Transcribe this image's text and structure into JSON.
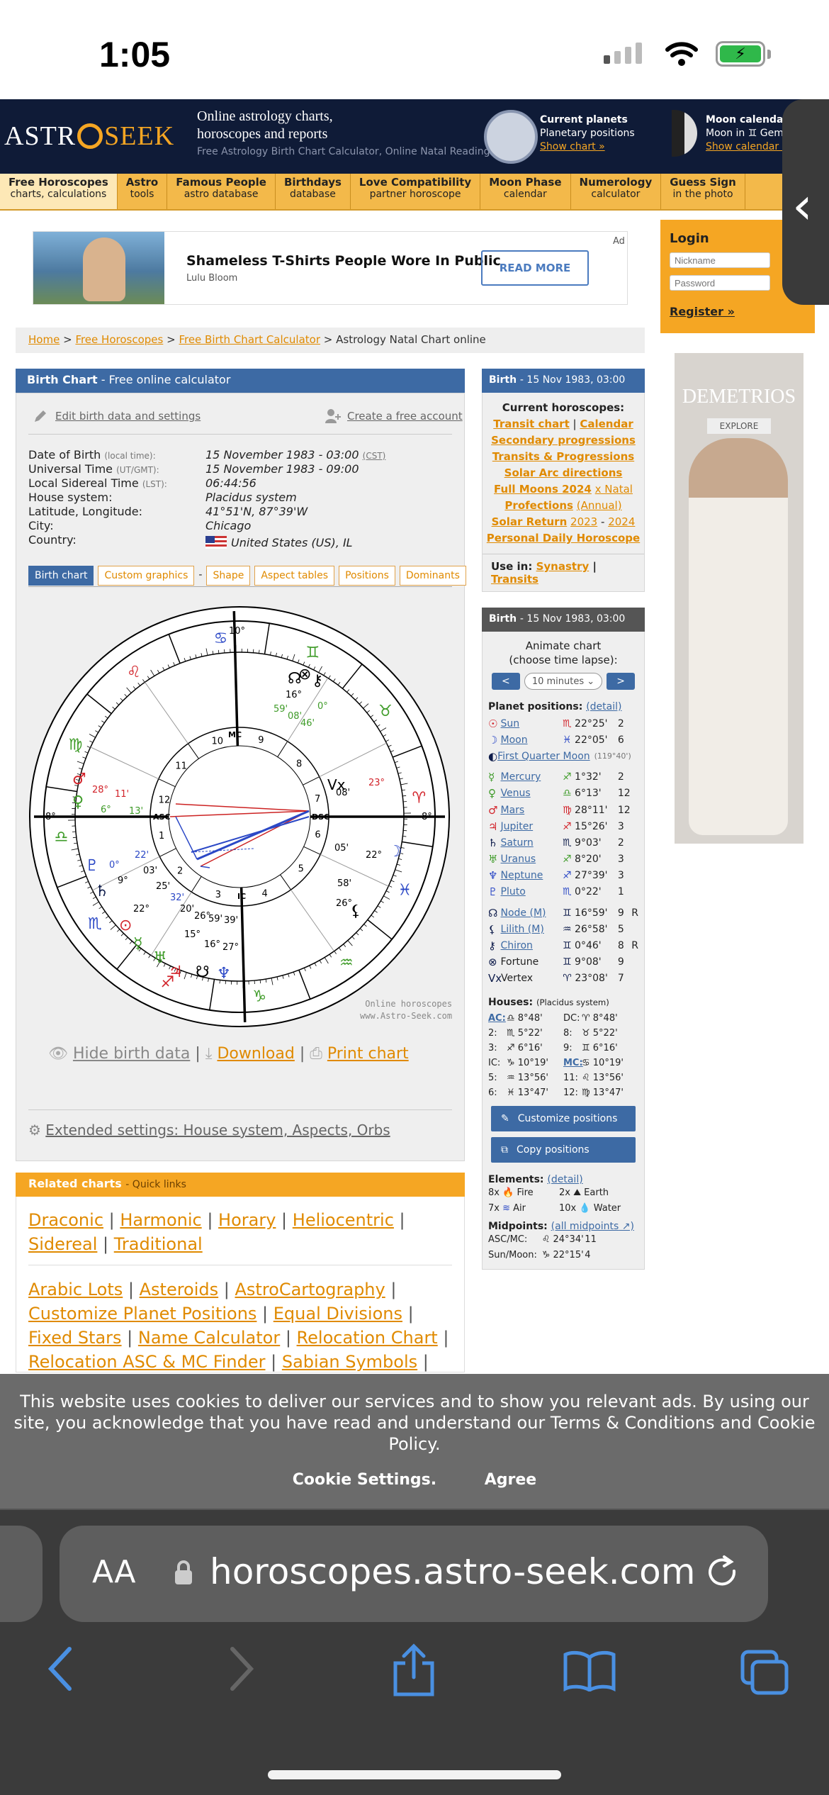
{
  "status": {
    "time": "1:05"
  },
  "header": {
    "logo_astro": "ASTR",
    "logo_seek": "SEEK",
    "tagline": "Online astrology charts, horoscopes and reports",
    "subtagline": "Free Astrology Birth Chart Calculator, Online Natal Reading",
    "planets_title": "Current planets",
    "planets_sub": "Planetary positions",
    "planets_link": "Show chart »",
    "moon_title": "Moon calendar",
    "moon_sub": "Moon in ♊ Gem",
    "moon_link": "Show calendar »"
  },
  "nav": [
    {
      "title": "Free Horoscopes",
      "sub": "charts, calculations"
    },
    {
      "title": "Astro",
      "sub": "tools"
    },
    {
      "title": "Famous People",
      "sub": "astro database"
    },
    {
      "title": "Birthdays",
      "sub": "database"
    },
    {
      "title": "Love Compatibility",
      "sub": "partner horoscope"
    },
    {
      "title": "Moon Phase",
      "sub": "calendar"
    },
    {
      "title": "Numerology",
      "sub": "calculator"
    },
    {
      "title": "Guess Sign",
      "sub": "in the photo"
    }
  ],
  "login": {
    "title": "Login",
    "nickname_placeholder": "Nickname",
    "password_placeholder": "Password",
    "register": "Register »"
  },
  "right_ad": {
    "brand": "DEMETRIOS",
    "cta": "EXPLORE"
  },
  "ad": {
    "title": "Shameless T-Shirts People Wore In Public",
    "source": "Lulu Bloom",
    "button": "READ MORE",
    "label": "Ad"
  },
  "breadcrumb": {
    "home": "Home",
    "sep": ">",
    "horoscopes": "Free Horoscopes",
    "calculator": "Free Birth Chart Calculator",
    "current": "Astrology Natal Chart online"
  },
  "birth_chart": {
    "title": "Birth Chart",
    "title_sub": "- Free online calculator",
    "edit_link": "Edit birth data and settings",
    "create_link": "Create a free account",
    "rows": [
      {
        "label": "Date of Birth",
        "note": "(local time):",
        "value": "15 November 1983 - 03:00",
        "vnote": "(CST)"
      },
      {
        "label": "Universal Time",
        "note": "(UT/GMT):",
        "value": "15 November 1983 - 09:00",
        "vnote": ""
      },
      {
        "label": "Local Sidereal Time",
        "note": "(LST):",
        "value": "06:44:56",
        "vnote": ""
      },
      {
        "label": "House system:",
        "note": "",
        "value": "Placidus system",
        "vnote": ""
      },
      {
        "label": "Latitude, Longitude:",
        "note": "",
        "value": "41°51'N, 87°39'W",
        "vnote": ""
      },
      {
        "label": "City:",
        "note": "",
        "value": "Chicago",
        "vnote": ""
      },
      {
        "label": "Country:",
        "note": "",
        "value": "United States (US), IL",
        "vnote": ""
      }
    ],
    "tabs": [
      "Birth chart",
      "Custom graphics",
      "-",
      "Shape",
      "Aspect tables",
      "Positions",
      "Dominants"
    ],
    "chart_source_1": "Online horoscopes",
    "chart_source_2": "www.Astro-Seek.com",
    "hide": "Hide birth data",
    "download": "Download",
    "print": "Print chart",
    "sep": "|",
    "extended": "Extended settings: House system, Aspects, Orbs"
  },
  "related": {
    "title": "Related charts",
    "sub": "- Quick links",
    "group1": [
      "Draconic",
      "Harmonic",
      "Horary",
      "Heliocentric",
      "Sidereal",
      "Traditional"
    ],
    "group2": [
      "Arabic Lots",
      "Asteroids",
      "AstroCartography",
      "Customize Planet Positions",
      "Equal Divisions",
      "Fixed Stars",
      "Name Calculator",
      "Relocation Chart",
      "Relocation ASC & MC Finder",
      "Sabian Symbols"
    ]
  },
  "side1": {
    "title": "Birth",
    "date": "- 15 Nov 1983, 03:00",
    "current": "Current horoscopes:",
    "transit": "Transit chart",
    "calendar": "Calendar",
    "secondary": "Secondary progressions",
    "transits_prog": "Transits & Progressions",
    "solar_arc": "Solar Arc directions",
    "full_moons": "Full Moons 2024",
    "full_moons_x": "x Natal",
    "profections": "Profections",
    "annual": "(Annual)",
    "solar_return": "Solar Return",
    "sr1": "2023",
    "sr_dash": "-",
    "sr2": "2024",
    "daily": "Personal Daily Horoscope",
    "use_in": "Use in:",
    "synastry": "Synastry",
    "transits": "Transits"
  },
  "side2": {
    "title": "Birth",
    "date": "- 15 Nov 1983, 03:00",
    "animate": "Animate chart",
    "lapse": "(choose time lapse):",
    "prev": "<",
    "next": ">",
    "interval": "10 minutes",
    "positions_title": "Planet positions:",
    "detail": "(detail)",
    "planets": [
      {
        "glyph": "☉",
        "name": "Sun",
        "sign": "♏",
        "pos": "22°25'",
        "house": "2",
        "r": "",
        "color": "red"
      },
      {
        "glyph": "☽",
        "name": "Moon",
        "sign": "♓",
        "pos": "22°05'",
        "house": "6",
        "r": "",
        "color": "blue"
      },
      {
        "glyph": "◐",
        "name": "First Quarter Moon",
        "sign": "",
        "pos": "(119°40')",
        "house": "",
        "r": "",
        "color": "navy"
      },
      {
        "glyph": "☿",
        "name": "Mercury",
        "sign": "♐",
        "pos": "1°32'",
        "house": "2",
        "r": "",
        "color": "green"
      },
      {
        "glyph": "♀",
        "name": "Venus",
        "sign": "♎",
        "pos": "6°13'",
        "house": "12",
        "r": "",
        "color": "green"
      },
      {
        "glyph": "♂",
        "name": "Mars",
        "sign": "♍",
        "pos": "28°11'",
        "house": "12",
        "r": "",
        "color": "red"
      },
      {
        "glyph": "♃",
        "name": "Jupiter",
        "sign": "♐",
        "pos": "15°26'",
        "house": "3",
        "r": "",
        "color": "red"
      },
      {
        "glyph": "♄",
        "name": "Saturn",
        "sign": "♏",
        "pos": "9°03'",
        "house": "2",
        "r": "",
        "color": "navy"
      },
      {
        "glyph": "♅",
        "name": "Uranus",
        "sign": "♐",
        "pos": "8°20'",
        "house": "3",
        "r": "",
        "color": "green"
      },
      {
        "glyph": "♆",
        "name": "Neptune",
        "sign": "♐",
        "pos": "27°39'",
        "house": "3",
        "r": "",
        "color": "blue"
      },
      {
        "glyph": "♇",
        "name": "Pluto",
        "sign": "♏",
        "pos": "0°22'",
        "house": "1",
        "r": "",
        "color": "blue"
      },
      {
        "glyph": "☊",
        "name": "Node (M)",
        "sign": "♊",
        "pos": "16°59'",
        "house": "9",
        "r": "R",
        "color": "navy"
      },
      {
        "glyph": "⚸",
        "name": "Lilith (M)",
        "sign": "♒",
        "pos": "26°58'",
        "house": "5",
        "r": "",
        "color": "navy"
      },
      {
        "glyph": "⚷",
        "name": "Chiron",
        "sign": "♊",
        "pos": "0°46'",
        "house": "8",
        "r": "R",
        "color": "navy"
      },
      {
        "glyph": "⊗",
        "name": "Fortune",
        "sign": "♊",
        "pos": "9°08'",
        "house": "9",
        "r": "",
        "color": "navy"
      },
      {
        "glyph": "Vx",
        "name": "Vertex",
        "sign": "♈",
        "pos": "23°08'",
        "house": "7",
        "r": "",
        "color": "navy"
      }
    ],
    "houses_title": "Houses:",
    "houses_system": "(Placidus system)",
    "houses": [
      [
        "AC:",
        "♎ 8°48'",
        "DC:",
        "♈ 8°48'"
      ],
      [
        "2:",
        "♏ 5°22'",
        "8:",
        "♉ 5°22'"
      ],
      [
        "3:",
        "♐ 6°16'",
        "9:",
        "♊ 6°16'"
      ],
      [
        "IC:",
        "♑ 10°19'",
        "MC:",
        "♋ 10°19'"
      ],
      [
        "5:",
        "♒ 13°56'",
        "11:",
        "♌ 13°56'"
      ],
      [
        "6:",
        "♓ 13°47'",
        "12:",
        "♍ 13°47'"
      ]
    ],
    "customize": "Customize positions",
    "copy": "Copy positions",
    "elements_title": "Elements:",
    "elements": [
      [
        "8x",
        "Fire",
        "2x",
        "Earth"
      ],
      [
        "7x",
        "Air",
        "10x",
        "Water"
      ]
    ],
    "midpoints_title": "Midpoints:",
    "midpoints_link": "(all midpoints",
    "midpoints": [
      [
        "ASC/MC:",
        "♌ 24°34'",
        "11"
      ],
      [
        "Sun/Moon:",
        "♑ 22°15'",
        "4"
      ]
    ]
  },
  "chart_wheel": {
    "angles": [
      "ASC",
      "DSC",
      "MC",
      "IC"
    ],
    "house_numbers": [
      "1",
      "2",
      "3",
      "4",
      "5",
      "6",
      "7",
      "8",
      "9",
      "10",
      "11",
      "12"
    ],
    "degree_labels": [
      "10°",
      "16°",
      "59'",
      "08'",
      "0°",
      "46'",
      "23°",
      "08'",
      "05'",
      "22°",
      "58'",
      "26°",
      "28°",
      "11'",
      "6°",
      "13'",
      "8°",
      "8°",
      "0°",
      "22'",
      "9°",
      "03'",
      "25'",
      "32'",
      "20'",
      "26°",
      "59'",
      "39'",
      "22°",
      "15°",
      "16°",
      "27°"
    ]
  },
  "cookie": {
    "text": "This website uses cookies to deliver our services and to show you relevant ads. By using our site, you acknowledge that you have read and understand our Terms & Conditions and Cookie Policy.",
    "settings": "Cookie Settings.",
    "agree": "Agree"
  },
  "safari": {
    "aa": "AA",
    "url": "horoscopes.astro-seek.com"
  },
  "colors": {
    "nav_bg": "#f3b94a",
    "header_bg": "#0f1b37",
    "accent": "#f5a623",
    "panel_blue": "#3d6aa4"
  }
}
